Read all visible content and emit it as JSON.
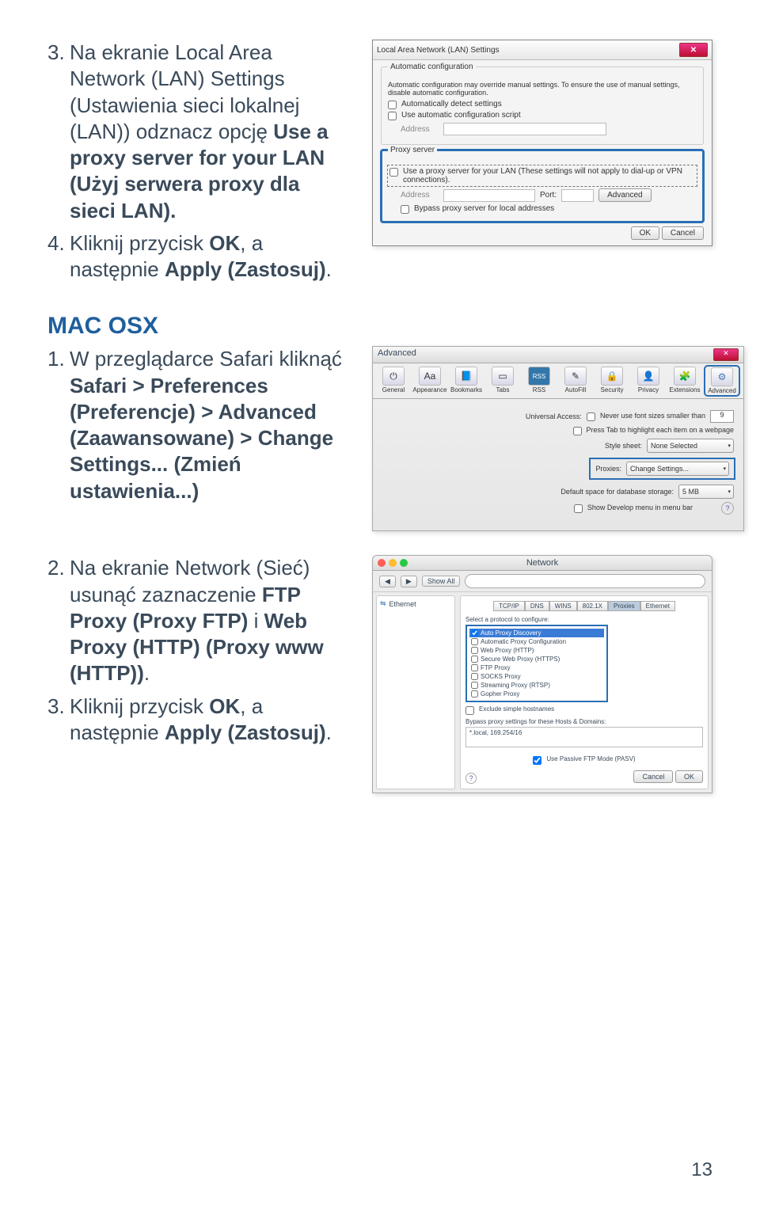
{
  "step3": {
    "num": "3.",
    "t1": "Na ekranie Local Area Network (LAN) Settings (Ustawienia sieci lokalnej (LAN)) odznacz opcję ",
    "b1": "Use a proxy server for your LAN (Użyj serwera proxy dla sieci LAN).",
    "t2": ""
  },
  "step4": {
    "num": "4.",
    "t1": "Kliknij przycisk ",
    "b1": "OK",
    "t2": ", a następnie ",
    "b2": "Apply (Zastosuj)",
    "t3": "."
  },
  "macHeading": "MAC OSX",
  "mac1": {
    "num": "1.",
    "t1": "W przeglądarce Safari kliknąć ",
    "b1": "Safari",
    "t2": " > ",
    "b2": "Preferences (Preferencje)",
    "t3": " > ",
    "b3": "Advanced (Zaawansowane)",
    "t4": " > ",
    "b4": "Change Settings... (Zmień ustawienia...)"
  },
  "mac2": {
    "num": "2.",
    "t1": "Na ekranie Network (Sieć) usunąć zaznaczenie ",
    "b1": "FTP Proxy (Proxy FTP)",
    "t2": " i ",
    "b2": "Web Proxy (HTTP) (Proxy www (HTTP))",
    "t3": "."
  },
  "mac3": {
    "num": "3.",
    "t1": "Kliknij przycisk ",
    "b1": "OK",
    "t2": ", a następnie ",
    "b2": "Apply (Zastosuj)",
    "t3": "."
  },
  "lan": {
    "title": "Local Area Network (LAN) Settings",
    "grp1": "Automatic configuration",
    "desc1": "Automatic configuration may override manual settings. To ensure the use of manual settings, disable automatic configuration.",
    "cb1": "Automatically detect settings",
    "cb2": "Use automatic configuration script",
    "addr": "Address",
    "grp2": "Proxy server",
    "cb3": "Use a proxy server for your LAN (These settings will not apply to dial-up or VPN connections).",
    "port": "Port:",
    "adv": "Advanced",
    "bypass": "Bypass proxy server for local addresses",
    "ok": "OK",
    "cancel": "Cancel"
  },
  "safari": {
    "title": "Advanced",
    "tabs": [
      "General",
      "Appearance",
      "Bookmarks",
      "Tabs",
      "RSS",
      "AutoFill",
      "Security",
      "Privacy",
      "Extensions",
      "Advanced"
    ],
    "ua": "Universal Access:",
    "ua1": "Never use font sizes smaller than",
    "ua1v": "9",
    "ua2": "Press Tab to highlight each item on a webpage",
    "ss": "Style sheet:",
    "ssv": "None Selected",
    "px": "Proxies:",
    "pxbtn": "Change Settings...",
    "db": "Default space for database storage:",
    "dbv": "5 MB",
    "devcb": "Show Develop menu in menu bar"
  },
  "net": {
    "title": "Network",
    "showall": "Show All",
    "eth": "Ethernet",
    "tabs": [
      "TCP/IP",
      "DNS",
      "WINS",
      "802.1X",
      "Proxies",
      "Ethernet"
    ],
    "protolabel": "Select a protocol to configure:",
    "protos": [
      "Auto Proxy Discovery",
      "Automatic Proxy Configuration",
      "Web Proxy (HTTP)",
      "Secure Web Proxy (HTTPS)",
      "FTP Proxy",
      "SOCKS Proxy",
      "Streaming Proxy (RTSP)",
      "Gopher Proxy"
    ],
    "exclude": "Exclude simple hostnames",
    "bypass": "Bypass proxy settings for these Hosts & Domains:",
    "bypassv": "*.local, 169.254/16",
    "pasv": "Use Passive FTP Mode (PASV)",
    "cancel": "Cancel",
    "ok": "OK"
  },
  "pageNum": "13"
}
